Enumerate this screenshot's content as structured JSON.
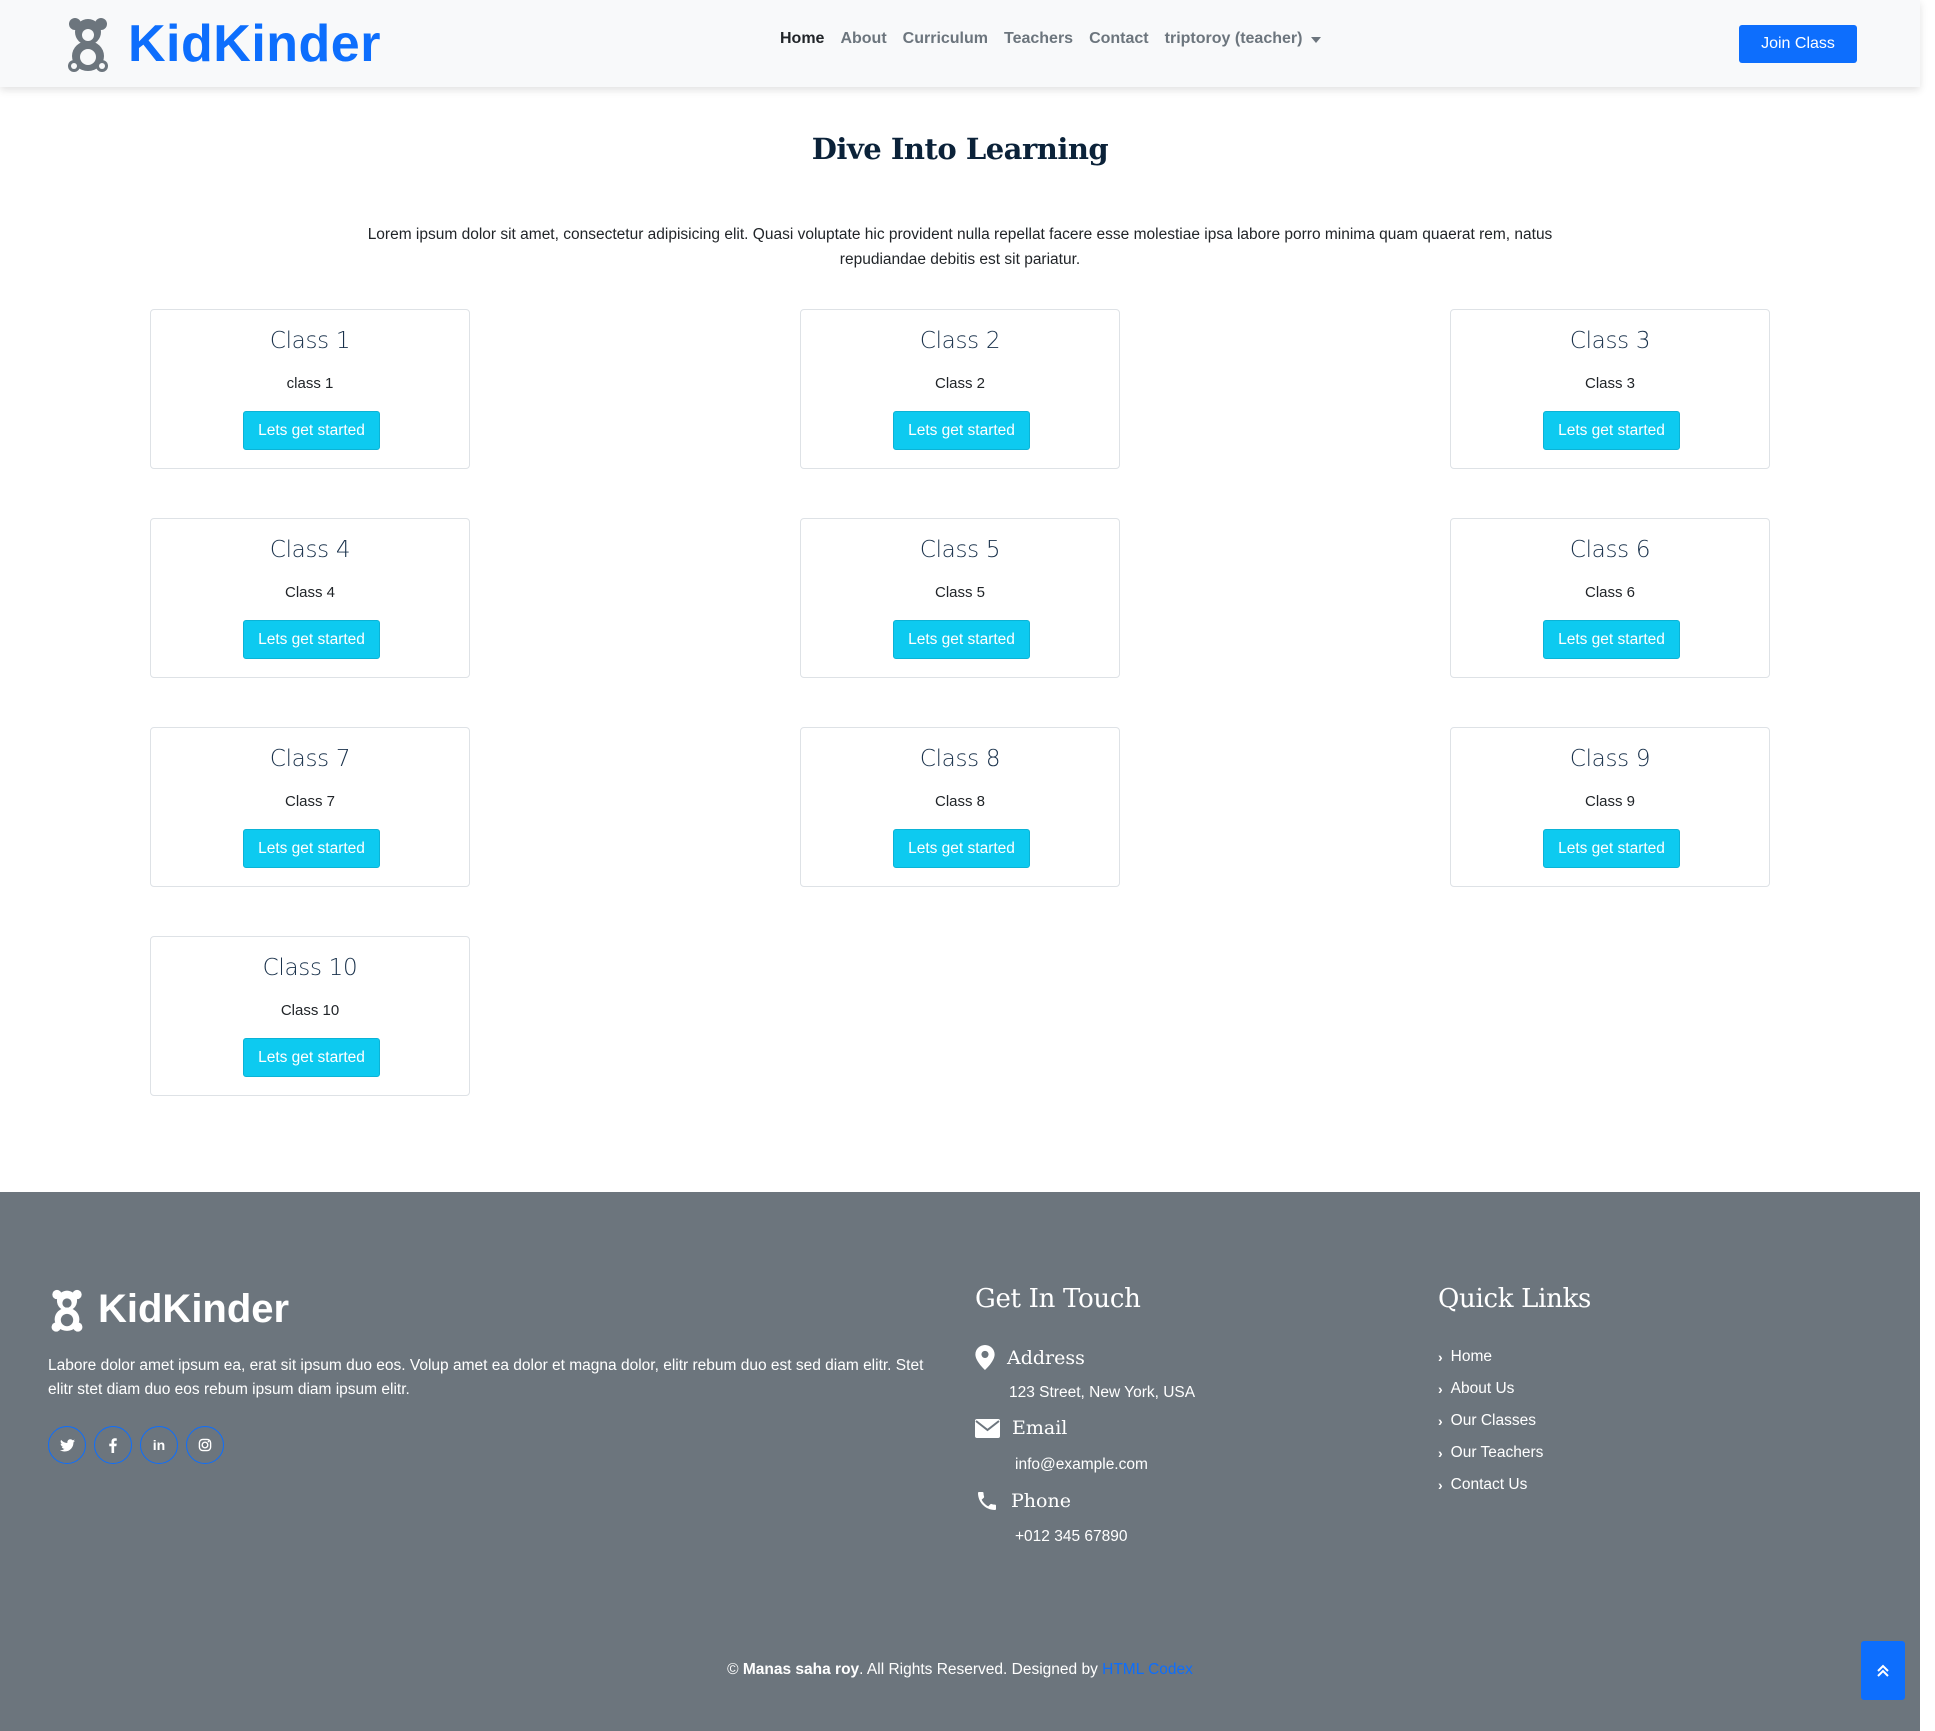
{
  "brand": {
    "name": "KidKinder",
    "color": "#0d6efd"
  },
  "nav": {
    "links": [
      "Home",
      "About",
      "Curriculum",
      "Teachers",
      "Contact"
    ],
    "user_name": "triptoroy",
    "user_role": "(teacher)",
    "cta": "Join Class"
  },
  "main": {
    "title": "Dive Into Learning",
    "lead": "Lorem ipsum dolor sit amet, consectetur adipisicing elit. Quasi voluptate hic provident nulla repellat facere esse molestiae ipsa labore porro minima quam quaerat rem, natus repudiandae debitis est sit pariatur.",
    "classes": [
      {
        "title": "Class 1",
        "text": "class 1",
        "button": "Lets get started"
      },
      {
        "title": "Class 2",
        "text": "Class 2",
        "button": "Lets get started"
      },
      {
        "title": "Class 3",
        "text": "Class 3",
        "button": "Lets get started"
      },
      {
        "title": "Class 4",
        "text": "Class 4",
        "button": "Lets get started"
      },
      {
        "title": "Class 5",
        "text": "Class 5",
        "button": "Lets get started"
      },
      {
        "title": "Class 6",
        "text": "Class 6",
        "button": "Lets get started"
      },
      {
        "title": "Class 7",
        "text": "Class 7",
        "button": "Lets get started"
      },
      {
        "title": "Class 8",
        "text": "Class 8",
        "button": "Lets get started"
      },
      {
        "title": "Class 9",
        "text": "Class 9",
        "button": "Lets get started"
      },
      {
        "title": "Class 10",
        "text": "Class 10",
        "button": "Lets get started"
      }
    ]
  },
  "footer": {
    "brand": "KidKinder",
    "about": "Labore dolor amet ipsum ea, erat sit ipsum duo eos. Volup amet ea dolor et magna dolor, elitr rebum duo est sed diam elitr. Stet elitr stet diam duo eos rebum ipsum diam ipsum elitr.",
    "socials": [
      "twitter-icon",
      "facebook-icon",
      "linkedin-icon",
      "instagram-icon"
    ],
    "contact_heading": "Get In Touch",
    "address_label": "Address",
    "address": "123 Street, New York, USA",
    "email_label": "Email",
    "email": "info@example.com",
    "phone_label": "Phone",
    "phone": "+012 345 67890",
    "links_heading": "Quick Links",
    "quick_links": [
      "Home",
      "About Us",
      "Our Classes",
      "Our Teachers",
      "Contact Us"
    ],
    "copyright_prefix": "©",
    "copyright_owner": "Manas saha roy",
    "copyright_mid": ". All Rights Reserved. Designed by",
    "copyright_credit": "HTML Codex"
  }
}
